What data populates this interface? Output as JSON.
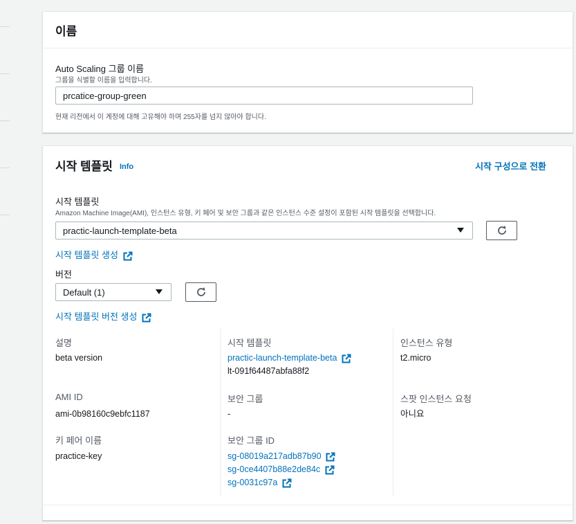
{
  "name_section": {
    "title": "이름",
    "field_label": "Auto Scaling 그룹 이름",
    "field_desc": "그룹을 식별할 이름을 입력합니다.",
    "field_value": "prcatice-group-green",
    "constraint": "현재 리전에서 이 계정에 대해 고유해야 하며 255자를 넘지 않아야 합니다."
  },
  "template_section": {
    "title": "시작 템플릿",
    "info": "Info",
    "switch_link": "시작 구성으로 전환",
    "template_label": "시작 템플릿",
    "template_desc": "Amazon Machine Image(AMI), 인스턴스 유형, 키 페어 및 보안 그룹과 같은 인스턴스 수준 설정이 포함된 시작 템플릿을 선택합니다.",
    "template_value": "practic-launch-template-beta",
    "create_template_link": "시작 템플릿 생성",
    "version_label": "버전",
    "version_value": "Default (1)",
    "create_version_link": "시작 템플릿 버전 생성"
  },
  "details": {
    "description_label": "설명",
    "description_value": "beta version",
    "launch_template_label": "시작 템플릿",
    "launch_template_name": "practic-launch-template-beta",
    "launch_template_id": "lt-091f64487abfa88f2",
    "instance_type_label": "인스턴스 유형",
    "instance_type_value": "t2.micro",
    "ami_label": "AMI ID",
    "ami_value": "ami-0b98160c9ebfc1187",
    "security_group_label": "보안 그룹",
    "security_group_value": "-",
    "spot_label": "스팟 인스턴스 요청",
    "spot_value": "아니요",
    "key_pair_label": "키 페어 이름",
    "key_pair_value": "practice-key",
    "sg_id_label": "보안 그룹 ID",
    "sg_ids": [
      "sg-08019a217adb87b90",
      "sg-0ce4407b88e2de84c",
      "sg-0031c97a"
    ]
  },
  "colors": {
    "link": "#0073bb",
    "text": "#16191f",
    "muted": "#545b64"
  }
}
